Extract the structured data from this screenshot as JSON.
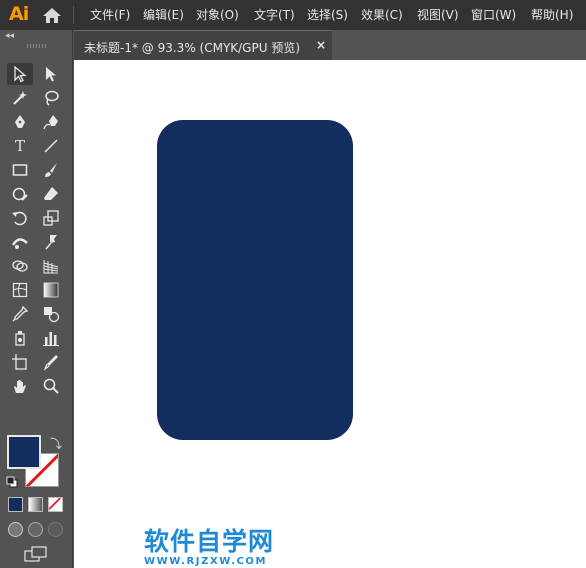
{
  "app": {
    "logo": "Ai"
  },
  "menu": [
    "文件(F)",
    "编辑(E)",
    "对象(O)",
    "文字(T)",
    "选择(S)",
    "效果(C)",
    "视图(V)",
    "窗口(W)",
    "帮助(H)"
  ],
  "toolbar": {
    "collapse_label": "◂◂",
    "type_tool_glyph": "T",
    "more_label": "..."
  },
  "colors": {
    "fill": "#142d5f",
    "stroke": "none",
    "accent": "#ff9a00",
    "watermark": "#1e8ad6"
  },
  "document": {
    "tab_label": "未标题-1* @ 93.3% (CMYK/GPU 预览)",
    "close_label": "×"
  },
  "watermark": {
    "title": "软件自学网",
    "url": "WWW.RJZXW.COM"
  }
}
